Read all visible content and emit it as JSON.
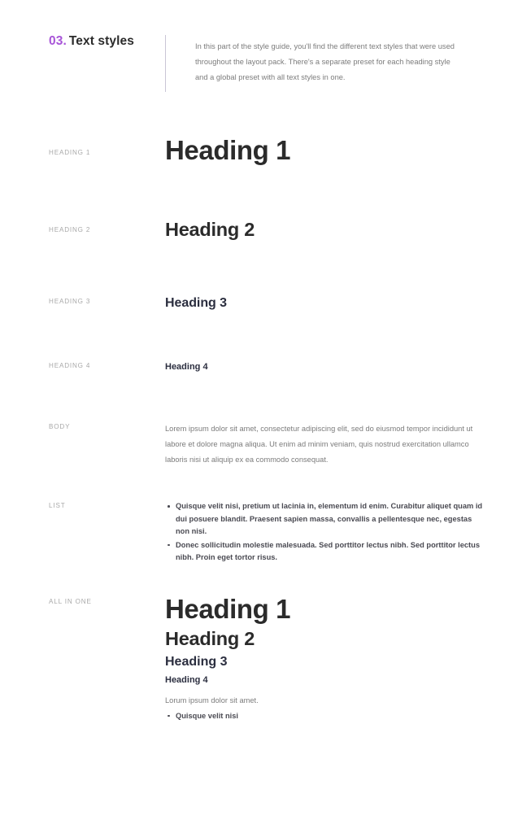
{
  "header": {
    "number": "03.",
    "title": "Text styles",
    "intro": "In this part of the style guide, you'll find the different text styles that were used throughout the layout pack. There's a separate preset for each heading style and a global preset with all text styles in one."
  },
  "rows": [
    {
      "label": "HEADING 1",
      "sample": "Heading 1"
    },
    {
      "label": "HEADING 2",
      "sample": "Heading 2"
    },
    {
      "label": "HEADING 3",
      "sample": "Heading 3"
    },
    {
      "label": "HEADING 4",
      "sample": "Heading 4"
    },
    {
      "label": "BODY",
      "sample": "Lorem ipsum dolor sit amet, consectetur adipiscing elit, sed do eiusmod tempor incididunt ut labore et dolore magna aliqua. Ut enim ad minim veniam, quis nostrud exercitation ullamco laboris nisi ut aliquip ex ea commodo consequat."
    },
    {
      "label": "LIST",
      "items": [
        "Quisque velit nisi, pretium ut lacinia in, elementum id enim. Curabitur aliquet quam id dui posuere blandit. Praesent sapien massa, convallis a pellentesque nec, egestas non nisi.",
        "Donec sollicitudin molestie malesuada. Sed porttitor lectus nibh. Sed porttitor lectus nibh. Proin eget tortor risus."
      ]
    },
    {
      "label": "ALL IN ONE",
      "heading1": "Heading 1",
      "heading2": "Heading 2",
      "heading3": "Heading 3",
      "heading4": "Heading 4",
      "body": "Lorum ipsum dolor sit amet.",
      "list_item": "Quisque velit nisi"
    }
  ],
  "colors": {
    "accent_purple": "#a855d8",
    "heading_dark": "#2b2b2b",
    "heading_navy": "#2b2e3f",
    "body_gray": "#7c7c7c",
    "label_gray": "#a9a9a9",
    "divider": "#c9c6d6",
    "background": "#ffffff"
  }
}
